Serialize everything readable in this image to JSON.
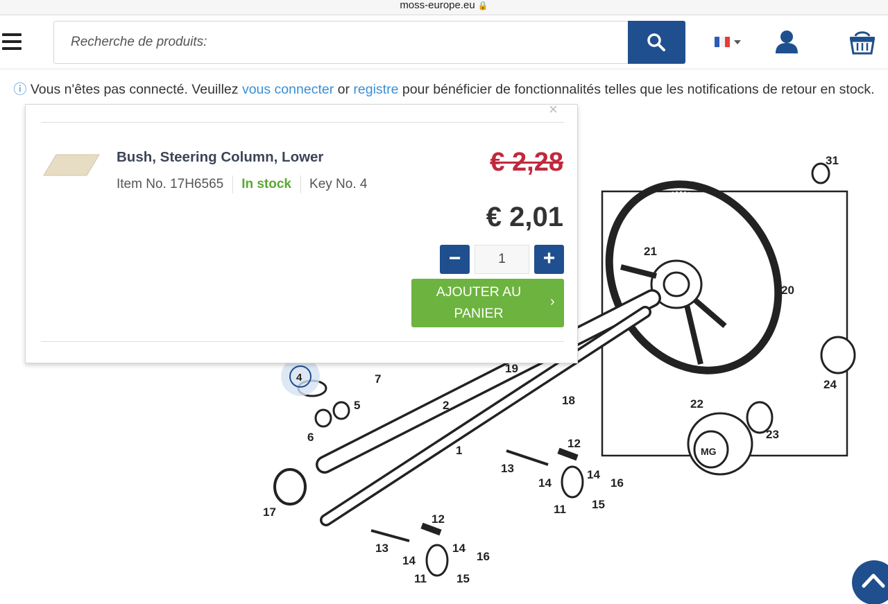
{
  "browser": {
    "url": "moss-europe.eu"
  },
  "header": {
    "search_placeholder": "Recherche de produits:",
    "language": "fr"
  },
  "notice": {
    "text_before": "Vous n'êtes pas connecté. Veuillez",
    "login_link": "vous connecter",
    "or": "or",
    "register_link": "registre",
    "text_after": "pour bénéficier de fonctionnalités telles que les notifications de retour en stock."
  },
  "popup": {
    "close_label": "×",
    "product_title": "Bush, Steering Column, Lower",
    "item_no": "Item No. 17H6565",
    "stock": "In stock",
    "key_no": "Key No. 4",
    "old_price": "€ 2,28",
    "new_price": "€ 2,01",
    "quantity": "1",
    "minus_label": "−",
    "plus_label": "+",
    "add_to_cart_line1": "AJOUTER AU",
    "add_to_cart_line2": "PANIER",
    "add_to_cart_chevron": "›"
  },
  "diagram": {
    "highlighted_key": "4",
    "labels": [
      "31",
      "21",
      "20",
      "24",
      "22",
      "23",
      "19",
      "18",
      "7",
      "2",
      "5",
      "6",
      "1",
      "12",
      "13",
      "14",
      "11",
      "15",
      "16",
      "17",
      "12",
      "13",
      "14",
      "11",
      "15",
      "16",
      "4"
    ]
  },
  "colors": {
    "primary": "#1f4f8e",
    "add_to_cart": "#6db33f",
    "old_price": "#c0293d",
    "in_stock": "#5aa831",
    "link": "#3a8fd6"
  }
}
